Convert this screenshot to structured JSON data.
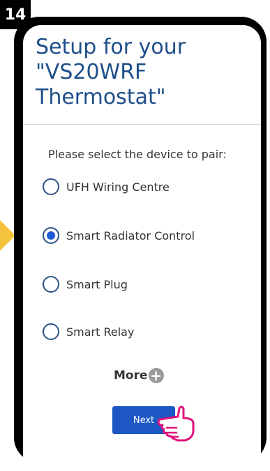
{
  "step": {
    "number": "14"
  },
  "screen": {
    "title": "Setup for your\n\"VS20WRF\nThermostat\"",
    "prompt": "Please select the device to pair:",
    "options": [
      {
        "label": "UFH Wiring Centre",
        "selected": false
      },
      {
        "label": "Smart Radiator Control",
        "selected": true
      },
      {
        "label": "Smart Plug",
        "selected": false
      },
      {
        "label": "Smart Relay",
        "selected": false
      }
    ],
    "more_label": "More",
    "next_label": "Next"
  },
  "colors": {
    "title": "#1f4f8a",
    "accent": "#1c57c4",
    "side_arrow": "#f5c33b",
    "hand_outline": "#e0127a"
  },
  "icons": {
    "more": "plus-circle-icon",
    "pointer": "pointing-hand-icon"
  }
}
